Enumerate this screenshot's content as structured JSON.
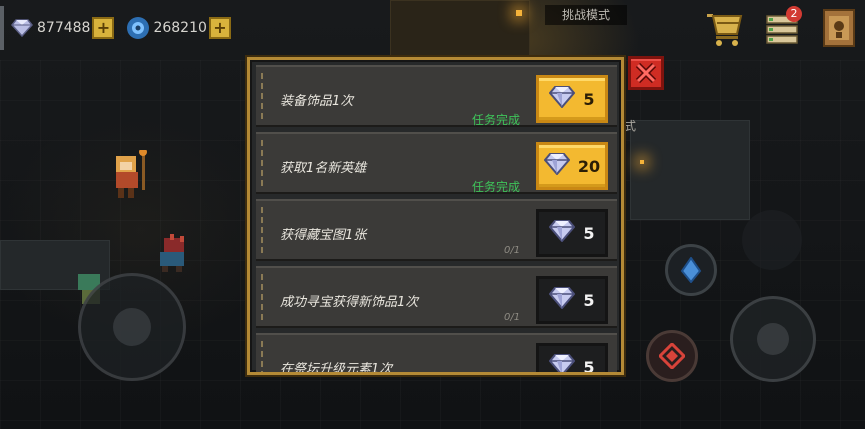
{
  "hud": {
    "gems": "877488",
    "energy": "268210",
    "gems_icon": "diamond-icon",
    "energy_icon": "gear-gem-icon",
    "add_icon": "plus-icon",
    "notification_count": "2"
  },
  "mode_labels": {
    "top": "挑战模式",
    "side": "模式"
  },
  "modal": {
    "tasks": [
      {
        "title": "装备饰品1次",
        "status": "任务完成",
        "progress": "",
        "reward": "5",
        "claimable": true
      },
      {
        "title": "获取1名新英雄",
        "status": "任务完成",
        "progress": "",
        "reward": "20",
        "claimable": true
      },
      {
        "title": "获得藏宝图1张",
        "status": "",
        "progress": "0/1",
        "reward": "5",
        "claimable": false
      },
      {
        "title": "成功寻宝获得新饰品1次",
        "status": "",
        "progress": "0/1",
        "reward": "5",
        "claimable": false
      },
      {
        "title": "在祭坛升级元素1次",
        "status": "",
        "progress": "",
        "reward": "5",
        "claimable": false
      }
    ],
    "close_icon": "close-icon"
  },
  "colors": {
    "accent_gold": "#f3b930",
    "complete_green": "#3ec45a",
    "close_red": "#cf2c23",
    "modal_border": "#b48a36"
  }
}
